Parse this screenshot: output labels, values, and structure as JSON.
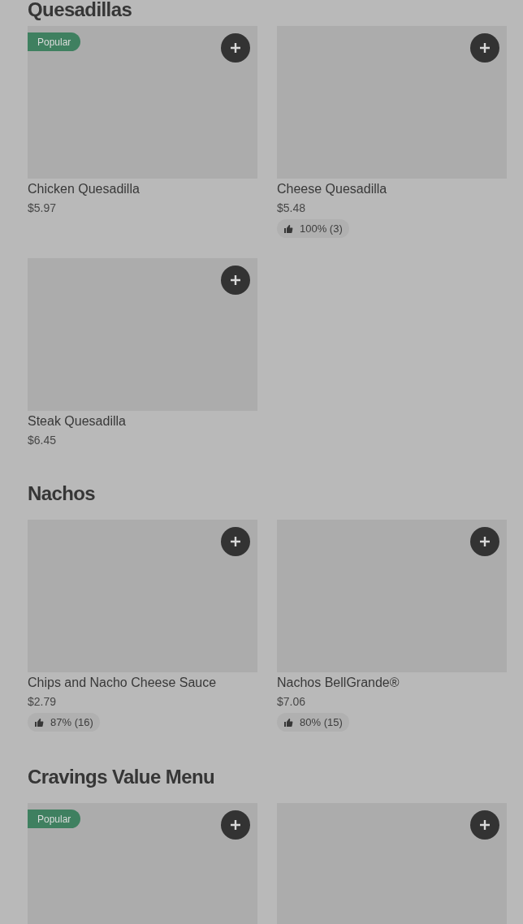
{
  "sections": [
    {
      "title": "Quesadillas",
      "items": [
        {
          "kind": "dish",
          "name": "Chicken Quesadilla",
          "price": "$5.97",
          "badge": "Popular"
        },
        {
          "kind": "dish",
          "name": "Cheese Quesadilla",
          "price": "$5.48",
          "rating": "100% (3)"
        },
        {
          "kind": "dish",
          "name": "Steak Quesadilla",
          "price": "$6.45"
        }
      ]
    },
    {
      "title": "Nachos",
      "items": [
        {
          "kind": "dish",
          "name": "Chips and Nacho Cheese Sauce",
          "price": "$2.79",
          "rating": "87% (16)"
        },
        {
          "kind": "dish",
          "name": "Nachos BellGrande®",
          "price": "$7.06",
          "rating": "80% (15)"
        }
      ]
    },
    {
      "title": "Cravings Value Menu",
      "items": [
        {
          "kind": "dish",
          "badge": "Popular"
        },
        {
          "kind": "dish"
        }
      ]
    }
  ]
}
